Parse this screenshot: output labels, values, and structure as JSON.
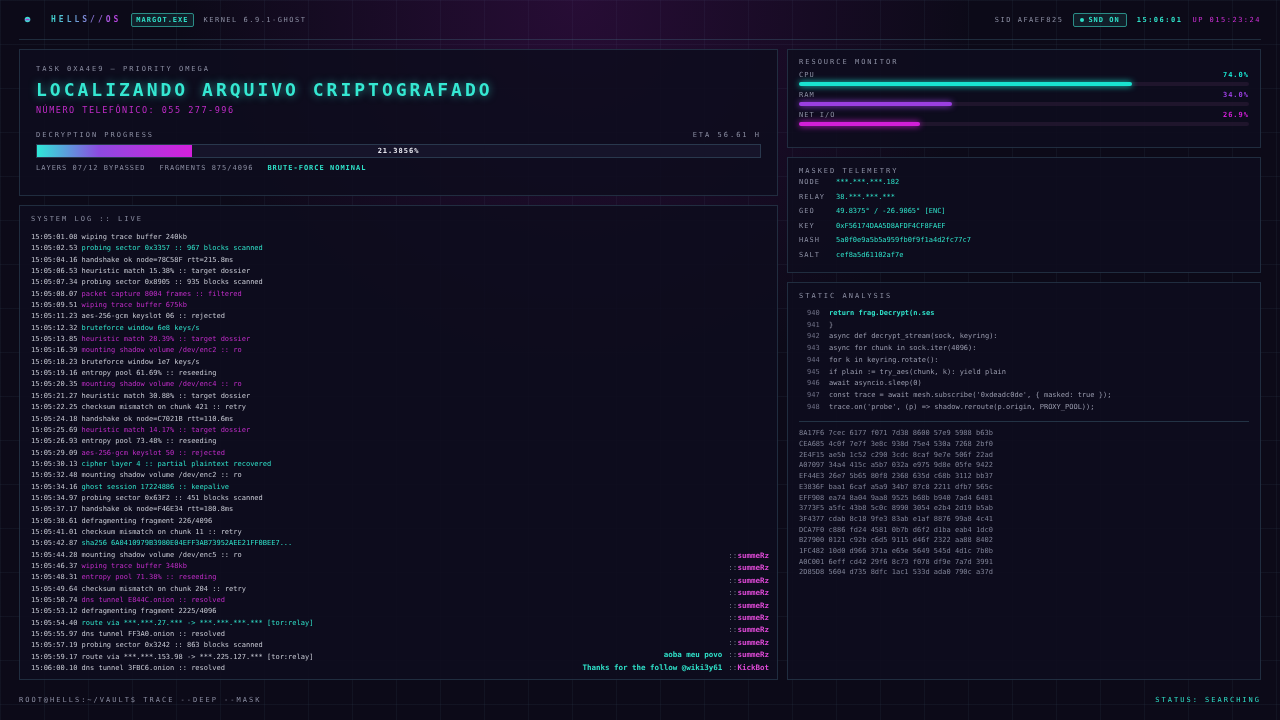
{
  "topbar": {
    "brand": "HELLS//OS",
    "badge": "MARGOT.EXE",
    "kernel": "KERNEL 6.9.1-GHOST",
    "sid": "SID AFAEF825",
    "sound": "SND ON",
    "clock": "15:06:01",
    "uptime": "UP 015:23:24"
  },
  "task": {
    "label": "TASK 0XA4E9 — PRIORITY OMEGA",
    "title": "LOCALIZANDO ARQUIVO CRIPTOGRAFADO",
    "subtitle": "NÚMERO TELEFÔNICO: 055 277-996",
    "progress_label": "DECRYPTION PROGRESS",
    "eta": "ETA 56.61 H",
    "progress": {
      "level": 0.2139,
      "reading": "21.3856%"
    },
    "stats": [
      {
        "text": "LAYERS 07/12 BYPASSED",
        "kind": "plain"
      },
      {
        "text": "FRAGMENTS 875/4096",
        "kind": "plain"
      },
      {
        "text": "BRUTE-FORCE NOMINAL",
        "kind": "ok"
      }
    ]
  },
  "log": {
    "title": "SYSTEM LOG :: LIVE",
    "lines": [
      {
        "time": "15:05:01.08",
        "text": "wiping trace buffer 240kb",
        "kind": "plain"
      },
      {
        "time": "15:05:02.53",
        "text": "probing sector 0x3357 :: 967 blocks scanned",
        "kind": "ok"
      },
      {
        "time": "15:05:04.16",
        "text": "handshake ok node=78C58F rtt=215.8ms",
        "kind": "plain"
      },
      {
        "time": "15:05:06.53",
        "text": "heuristic match 15.38% :: target dossier",
        "kind": "plain"
      },
      {
        "time": "15:05:07.34",
        "text": "probing sector 0x8905 :: 935 blocks scanned",
        "kind": "plain"
      },
      {
        "time": "15:05:08.07",
        "text": "packet capture 8004 frames :: filtered",
        "kind": "alert"
      },
      {
        "time": "15:05:09.51",
        "text": "wiping trace buffer 675kb",
        "kind": "alert"
      },
      {
        "time": "15:05:11.23",
        "text": "aes-256-gcm keyslot 06 :: rejected",
        "kind": "plain"
      },
      {
        "time": "15:05:12.32",
        "text": "bruteforce window 6e8 keys/s",
        "kind": "ok"
      },
      {
        "time": "15:05:13.85",
        "text": "heuristic match 28.39% :: target dossier",
        "kind": "alert"
      },
      {
        "time": "15:05:16.39",
        "text": "mounting shadow volume /dev/enc2 :: ro",
        "kind": "alert"
      },
      {
        "time": "15:05:18.23",
        "text": "bruteforce window 1e7 keys/s",
        "kind": "plain"
      },
      {
        "time": "15:05:19.16",
        "text": "entropy pool 61.69% :: reseeding",
        "kind": "plain"
      },
      {
        "time": "15:05:20.35",
        "text": "mounting shadow volume /dev/enc4 :: ro",
        "kind": "alert"
      },
      {
        "time": "15:05:21.27",
        "text": "heuristic match 30.88% :: target dossier",
        "kind": "plain"
      },
      {
        "time": "15:05:22.25",
        "text": "checksum mismatch on chunk 421 :: retry",
        "kind": "plain"
      },
      {
        "time": "15:05:24.18",
        "text": "handshake ok node=C7021B rtt=110.6ms",
        "kind": "plain"
      },
      {
        "time": "15:05:25.69",
        "text": "heuristic match 14.17% :: target dossier",
        "kind": "alert"
      },
      {
        "time": "15:05:26.93",
        "text": "entropy pool 73.48% :: reseeding",
        "kind": "plain"
      },
      {
        "time": "15:05:29.09",
        "text": "aes-256-gcm keyslot 50 :: rejected",
        "kind": "alert"
      },
      {
        "time": "15:05:30.13",
        "text": "cipher layer 4 :: partial plaintext recovered",
        "kind": "ok"
      },
      {
        "time": "15:05:32.48",
        "text": "mounting shadow volume /dev/enc2 :: ro",
        "kind": "plain"
      },
      {
        "time": "15:05:34.16",
        "text": "ghost session 17224886 :: keepalive",
        "kind": "ok"
      },
      {
        "time": "15:05:34.97",
        "text": "probing sector 0x63F2 :: 451 blocks scanned",
        "kind": "plain"
      },
      {
        "time": "15:05:37.17",
        "text": "handshake ok node=F46E34 rtt=180.8ms",
        "kind": "plain"
      },
      {
        "time": "15:05:38.61",
        "text": "defragmenting fragment 226/4096",
        "kind": "plain"
      },
      {
        "time": "15:05:41.01",
        "text": "checksum mismatch on chunk 11 :: retry",
        "kind": "plain"
      },
      {
        "time": "15:05:42.87",
        "text": "sha256 6A0410979B3980E04EFF3AB73952AEE21FF0BEE7...",
        "kind": "ok"
      },
      {
        "time": "15:05:44.28",
        "text": "mounting shadow volume /dev/enc5 :: ro",
        "kind": "plain"
      },
      {
        "time": "15:05:46.37",
        "text": "wiping trace buffer 348kb",
        "kind": "alert"
      },
      {
        "time": "15:05:48.31",
        "text": "entropy pool 71.38% :: reseeding",
        "kind": "alert"
      },
      {
        "time": "15:05:49.64",
        "text": "checksum mismatch on chunk 204 :: retry",
        "kind": "plain"
      },
      {
        "time": "15:05:50.74",
        "text": "dns tunnel E844C.onion :: resolved",
        "kind": "alert"
      },
      {
        "time": "15:05:53.12",
        "text": "defragmenting fragment 2225/4096",
        "kind": "plain"
      },
      {
        "time": "15:05:54.40",
        "text": "route via ***.***.27.*** -> ***.***.***.*** [tor:relay]",
        "kind": "ok"
      },
      {
        "time": "15:05:55.97",
        "text": "dns tunnel FF3A0.onion :: resolved",
        "kind": "plain"
      },
      {
        "time": "15:05:57.19",
        "text": "probing sector 0x3242 :: 863 blocks scanned",
        "kind": "plain"
      },
      {
        "time": "15:05:59.17",
        "text": "route via ***.***.153.98 -> ***.225.127.*** [tor:relay]",
        "kind": "plain"
      },
      {
        "time": "15:06:00.10",
        "text": "dns tunnel 3FBC6.onion :: resolved",
        "kind": "plain"
      }
    ]
  },
  "chat": [
    {
      "prefix": "::",
      "author": "summeRz"
    },
    {
      "prefix": "::",
      "author": "summeRz"
    },
    {
      "prefix": "::",
      "author": "summeRz"
    },
    {
      "prefix": "::",
      "author": "summeRz"
    },
    {
      "prefix": "::",
      "author": "summeRz"
    },
    {
      "prefix": "::",
      "author": "summeRz"
    },
    {
      "prefix": "::",
      "author": "summeRz"
    },
    {
      "prefix": "::",
      "author": "summeRz"
    },
    {
      "message": "aoba meu povo",
      "prefix": "::",
      "author": "summeRz"
    },
    {
      "message": "Thanks for the follow @wiki3y61",
      "prefix": "::",
      "author": "KickBot"
    }
  ],
  "resources": {
    "title": "RESOURCE MONITOR",
    "items": [
      {
        "name": "CPU",
        "reading": "74.0%",
        "level": 0.74,
        "color": "#19e3d0"
      },
      {
        "name": "RAM",
        "reading": "34.0%",
        "level": 0.34,
        "color": "#9b3fe0"
      },
      {
        "name": "NET I/O",
        "reading": "26.9%",
        "level": 0.269,
        "color": "#d21fd8"
      }
    ]
  },
  "telemetry": {
    "title": "MASKED TELEMETRY",
    "rows": [
      {
        "key": "NODE",
        "value": "***.***.***.182"
      },
      {
        "key": "RELAY",
        "value": "38.***.***.***"
      },
      {
        "key": "GEO",
        "value": "49.8375° / -26.9065° [ENC]"
      },
      {
        "key": "KEY",
        "value": "0xF56174DAA5D8AFDF4CF8FAEF"
      },
      {
        "key": "HASH",
        "value": "5a0f0e9a5b5a959fb0f9f1a4d2fc77c7"
      },
      {
        "key": "SALT",
        "value": "cef8a5d61102af7e"
      }
    ]
  },
  "analysis": {
    "title": "STATIC ANALYSIS",
    "code": [
      {
        "number": "940",
        "text": "return frag.Decrypt(n.ses",
        "highlighted": true
      },
      {
        "number": "941",
        "text": "}",
        "highlighted": false
      },
      {
        "number": "942",
        "text": "async def decrypt_stream(sock, keyring):",
        "highlighted": false
      },
      {
        "number": "943",
        "text": "async for chunk in sock.iter(4096):",
        "highlighted": false
      },
      {
        "number": "944",
        "text": "for k in keyring.rotate():",
        "highlighted": false
      },
      {
        "number": "945",
        "text": "if plain := try_aes(chunk, k): yield plain",
        "highlighted": false
      },
      {
        "number": "946",
        "text": "await asyncio.sleep(0)",
        "highlighted": false
      },
      {
        "number": "947",
        "text": "const trace = await mesh.subscribe('0xdeadc0de', { masked: true });",
        "highlighted": false
      },
      {
        "number": "948",
        "text": "trace.on('probe', (p) => shadow.reroute(p.origin, PROXY_POOL));",
        "highlighted": false
      }
    ],
    "hex": [
      "8A17F6 7cec 6177 f071 7d38 8600 57e9 5988 b63b",
      "CEA685 4c0f 7e7f 3e8c 938d 75e4 530a 7268 2bf0",
      "2E4F15 ae5b 1c52 c290 3cdc 8caf 9e7e 506f 22ad",
      "A07097 34a4 415c a5b7 032a e975 9d8e 05fe 9422",
      "EF44E3 26e7 5b65 80f8 2368 635d c68b 3112 bb37",
      "E3836F baa1 6caf a5a9 34b7 87c8 2211 dfb7 565c",
      "EFF908 ea74 8a04 9aa8 9525 b68b b940 7ad4 6481",
      "3773F5 a5fc 43b8 5c0c 8990 3054 e2b4 2d19 b5ab",
      "3F4377 cdab 8c18 9fe3 83ab e1af 8876 99a8 4c41",
      "DCA7F0 c886 fd24 4581 0b7b d6f2 d1ba eab4 1dc0",
      "B27900 0121 c92b c6d5 9115 d46f 2322 aa88 8402",
      "1FC482 10d0 d966 371a e65e 5649 545d 4d1c 7b0b",
      "A0C001 6eff cd42 29f6 8c73 f078 df9e 7a7d 3991",
      "2D85D8 5604 d735 8dfc 1ac1 533d ada0 790c a37d"
    ]
  },
  "footer": {
    "prompt": "ROOT@HELLS:~/VAULT$ TRACE --DEEP --MASK",
    "status": "STATUS: SEARCHING"
  }
}
